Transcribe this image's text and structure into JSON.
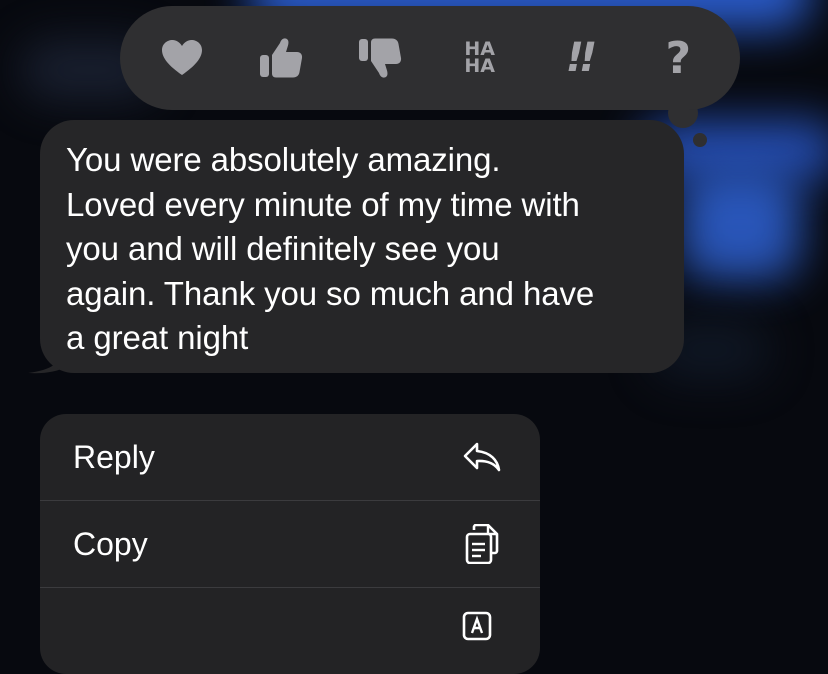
{
  "tapbacks": [
    {
      "name": "heart",
      "icon": "heart-icon"
    },
    {
      "name": "thumbs-up",
      "icon": "thumbs-up-icon"
    },
    {
      "name": "thumbs-down",
      "icon": "thumbs-down-icon"
    },
    {
      "name": "haha",
      "line1": "HA",
      "line2": "HA"
    },
    {
      "name": "emphasize",
      "label": "!!"
    },
    {
      "name": "question",
      "label": "?"
    }
  ],
  "message": {
    "text": "You were absolutely amazing.\nLoved every minute of my time with\nyou and will definitely see you\nagain. Thank you so much and have\na great night"
  },
  "menu": {
    "items": [
      {
        "label": "Reply",
        "icon": "reply-icon"
      },
      {
        "label": "Copy",
        "icon": "copy-icon"
      },
      {
        "label": "",
        "icon": "translate-icon"
      }
    ]
  },
  "colors": {
    "background": "#07090f",
    "bubble": "#262628",
    "tapback_bar": "#2f2f31",
    "menu": "#232325",
    "icon_gray": "#a3a3a8",
    "text": "#ffffff",
    "blur_blue": "#2d62d9"
  }
}
